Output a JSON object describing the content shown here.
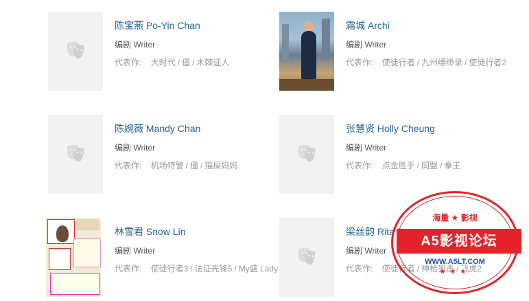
{
  "people": [
    {
      "name": "陈宝燕 Po-Yin Chan",
      "role": "编剧 Writer",
      "label": "代表作:",
      "works": [
        "大时代",
        "僵",
        "木棘证人"
      ]
    },
    {
      "name": "霜城 Archi",
      "role": "编剧 Writer",
      "label": "代表作:",
      "works": [
        "使徒行者",
        "九州缥缈录",
        "使徒行者2"
      ]
    },
    {
      "name": "陈婉薇 Mandy Chan",
      "role": "编剧 Writer",
      "label": "代表作:",
      "works": [
        "机场特警",
        "僵",
        "猫屎妈妈"
      ]
    },
    {
      "name": "张慧贤 Holly Cheung",
      "role": "编剧 Writer",
      "label": "代表作:",
      "works": [
        "点金胜手",
        "同盟",
        "拳王"
      ]
    },
    {
      "name": "林雪君 Snow Lin",
      "role": "编剧 Writer",
      "label": "代表作:",
      "works": [
        "使徒行者3",
        "法证先锋5",
        "My盛 Lady"
      ]
    },
    {
      "name": "梁丝韵 Rita Leung",
      "role": "编剧 Writer",
      "label": "代表作:",
      "works": [
        "使徒行者",
        "神枪狙击",
        "飞虎2"
      ]
    }
  ],
  "separator": "/",
  "watermark": {
    "top": "海量 ★ 影视",
    "main": "A5影视论坛",
    "url": "WWW.A5LT.COM",
    "color": "#e4222a"
  }
}
